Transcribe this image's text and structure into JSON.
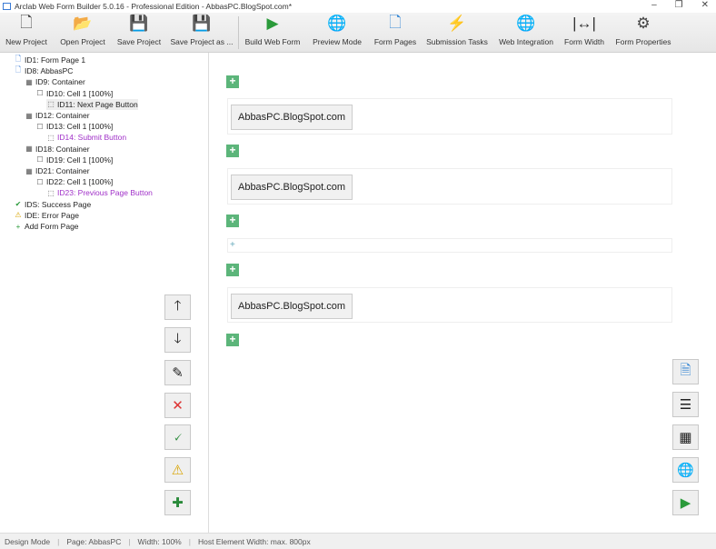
{
  "window": {
    "title": "Arclab Web Form Builder 5.0.16 - Professional Edition - AbbasPC.BlogSpot.com*",
    "min": "–",
    "max": "❐",
    "close": "✕"
  },
  "toolbar": [
    {
      "label": "New Project",
      "icon": "🗋"
    },
    {
      "label": "Open Project",
      "icon": "📂"
    },
    {
      "label": "Save Project",
      "icon": "💾"
    },
    {
      "label": "Save Project as ...",
      "icon": "💾"
    },
    {
      "label": "Build Web Form",
      "icon": "▶"
    },
    {
      "label": "Preview Mode",
      "icon": "🌐"
    },
    {
      "label": "Form Pages",
      "icon": "🗋"
    },
    {
      "label": "Submission Tasks",
      "icon": "⚡"
    },
    {
      "label": "Web Integration",
      "icon": "🌐"
    },
    {
      "label": "Form Width",
      "icon": "|↔|"
    },
    {
      "label": "Form Properties",
      "icon": "⚙"
    }
  ],
  "tree": [
    {
      "label": "ID1: Form Page 1",
      "level": 0,
      "icon": "🗋"
    },
    {
      "label": "ID8: AbbasPC",
      "level": 0,
      "icon": "🗋"
    },
    {
      "label": "ID9: Container",
      "level": 1,
      "icon": "▦"
    },
    {
      "label": "ID10: Cell 1 [100%]",
      "level": 2,
      "icon": "☐"
    },
    {
      "label": "ID11: Next Page Button",
      "level": 3,
      "icon": "⬚"
    },
    {
      "label": "ID12: Container",
      "level": 1,
      "icon": "▦"
    },
    {
      "label": "ID13: Cell 1 [100%]",
      "level": 2,
      "icon": "☐"
    },
    {
      "label": "ID14: Submit Button",
      "level": 3,
      "icon": "⬚",
      "purple": true
    },
    {
      "label": "ID18: Container",
      "level": 1,
      "icon": "▦"
    },
    {
      "label": "ID19: Cell 1 [100%]",
      "level": 2,
      "icon": "☐"
    },
    {
      "label": "ID21: Container",
      "level": 1,
      "icon": "▦"
    },
    {
      "label": "ID22: Cell 1 [100%]",
      "level": 2,
      "icon": "☐"
    },
    {
      "label": "ID23: Previous Page Button",
      "level": 3,
      "icon": "⬚",
      "purple": true
    },
    {
      "label": "IDS: Success Page",
      "level": 0,
      "icon": "✔"
    },
    {
      "label": "IDE: Error Page",
      "level": 0,
      "icon": "⚠"
    },
    {
      "label": "Add Form Page",
      "level": 0,
      "icon": "+"
    }
  ],
  "canvas": {
    "button_text": "AbbasPC.BlogSpot.com",
    "plus": "+"
  },
  "status": {
    "mode": "Design Mode",
    "page": "Page: AbbasPC",
    "width": "Width: 100%",
    "host": "Host Element Width: max. 800px"
  }
}
